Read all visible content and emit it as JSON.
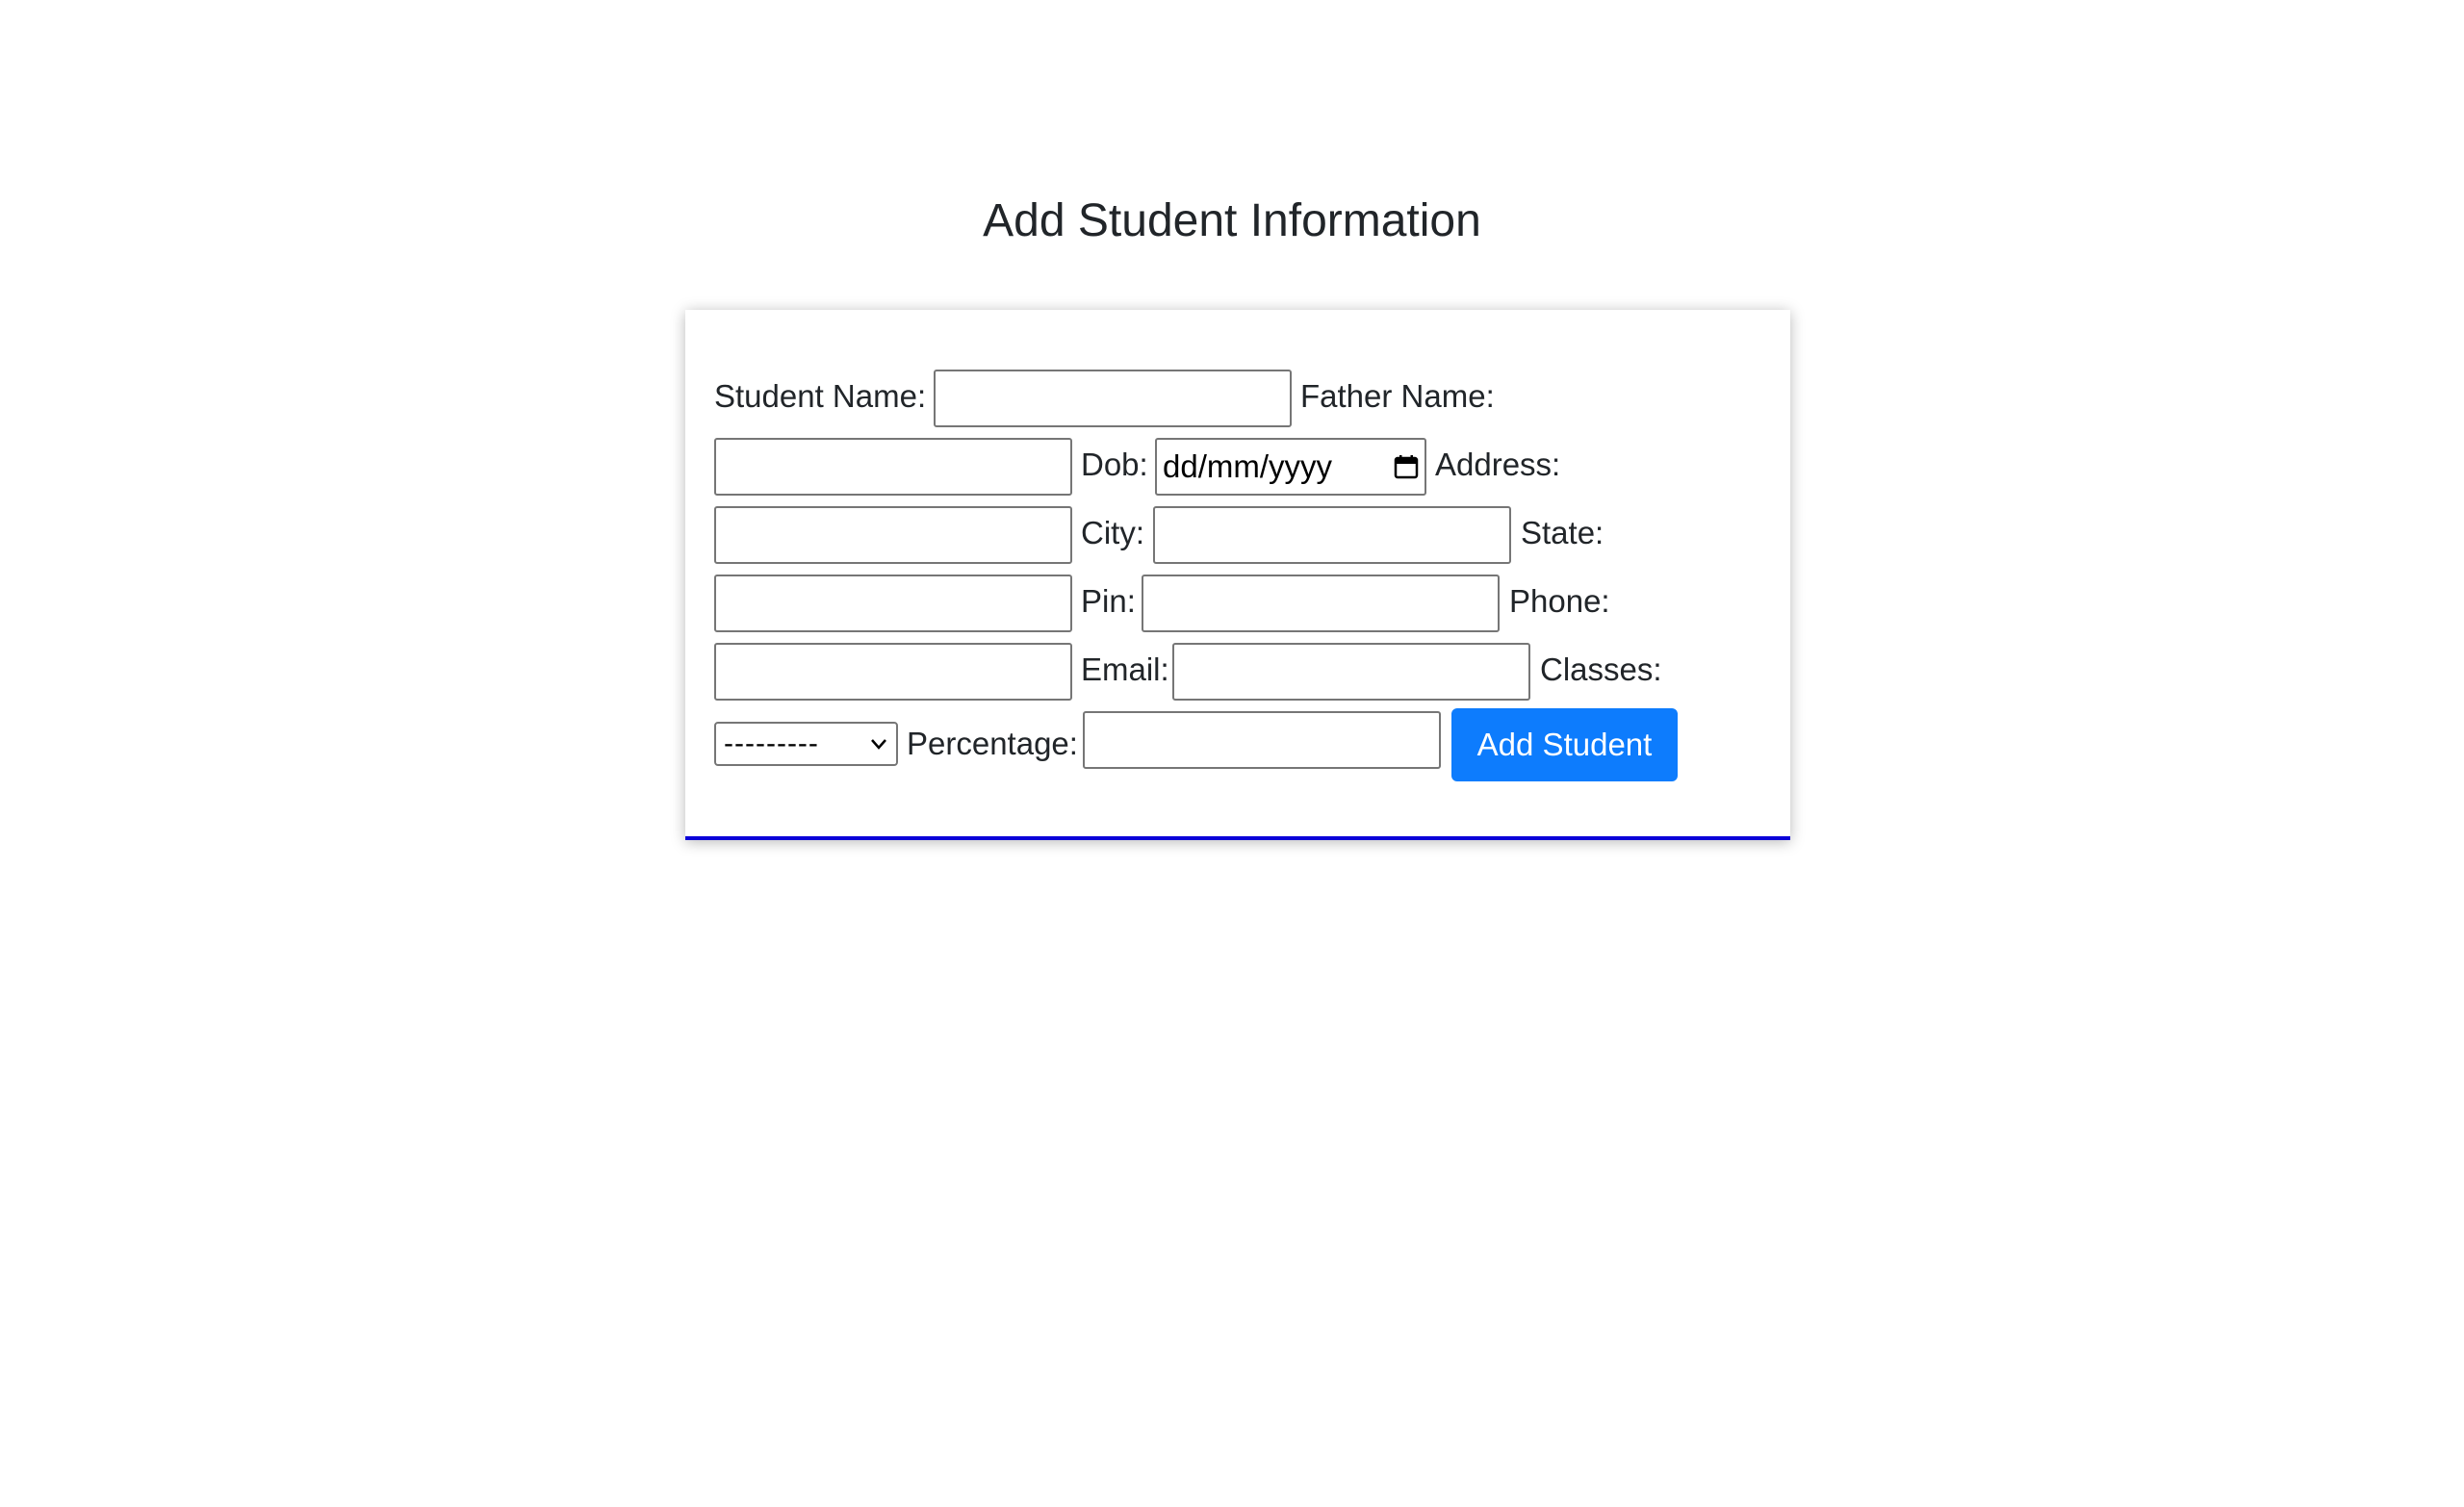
{
  "page": {
    "title": "Add Student Information"
  },
  "form": {
    "student_name_label": "Student Name:",
    "student_name_value": "",
    "father_name_label": "Father Name:",
    "father_name_value": "",
    "dob_label": "Dob:",
    "dob_placeholder": "dd/mm/yyyy",
    "address_label": "Address:",
    "address_value": "",
    "city_label": "City:",
    "city_value": "",
    "state_label": "State:",
    "state_value": "",
    "pin_label": "Pin:",
    "pin_value": "",
    "phone_label": "Phone:",
    "phone_value": "",
    "email_label": "Email:",
    "email_value": "",
    "classes_label": "Classes:",
    "classes_selected": "---------",
    "percentage_label": "Percentage:",
    "percentage_value": "",
    "submit_label": "Add Student"
  },
  "colors": {
    "button_bg": "#0d7cfd",
    "card_border_bottom": "#0b00d8",
    "title_text": "#212529"
  }
}
